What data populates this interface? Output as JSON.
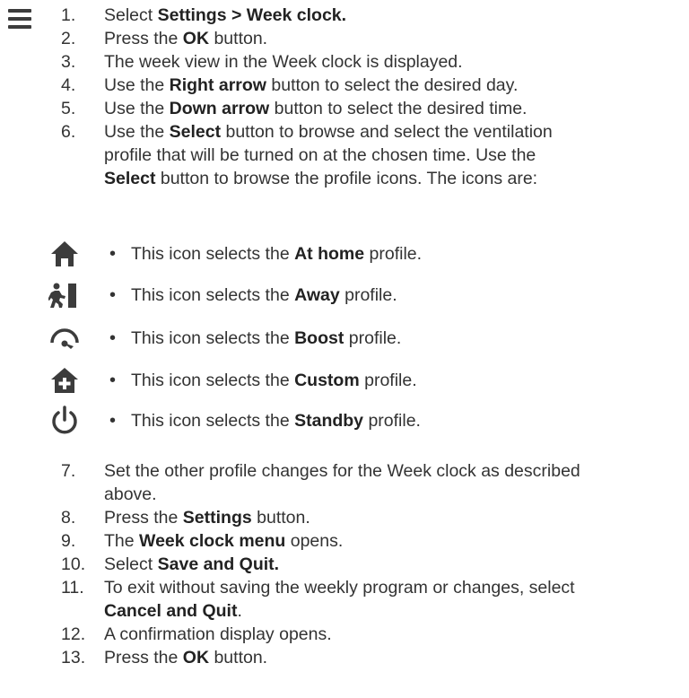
{
  "steps_a": [
    {
      "num": "1.",
      "parts": [
        {
          "t": "Select "
        },
        {
          "b": "Settings > Week clock."
        }
      ]
    },
    {
      "num": "2.",
      "parts": [
        {
          "t": "Press the "
        },
        {
          "b": "OK"
        },
        {
          "t": " button."
        }
      ]
    },
    {
      "num": "3.",
      "parts": [
        {
          "t": "The week view in the Week clock is displayed."
        }
      ]
    },
    {
      "num": "4.",
      "parts": [
        {
          "t": "Use the "
        },
        {
          "b": "Right arrow"
        },
        {
          "t": " button to select the desired day."
        }
      ]
    },
    {
      "num": "5.",
      "parts": [
        {
          "t": "Use the "
        },
        {
          "b": "Down arrow"
        },
        {
          "t": " button to select the desired time."
        }
      ]
    },
    {
      "num": "6.",
      "lines": [
        [
          {
            "t": "Use the "
          },
          {
            "b": "Select"
          },
          {
            "t": " button to browse and select the ventilation"
          }
        ],
        [
          {
            "t": "profile that will be turned on at the chosen time. Use the"
          }
        ],
        [
          {
            "b": "Select"
          },
          {
            "t": " button to browse the profile icons. The icons are:"
          }
        ]
      ]
    }
  ],
  "profiles": [
    {
      "icon": "home-icon",
      "pre": "This icon selects the ",
      "name": "At home",
      "post": " profile."
    },
    {
      "icon": "away-icon",
      "pre": "This icon selects the ",
      "name": "Away",
      "post": " profile."
    },
    {
      "icon": "boost-icon",
      "pre": "This icon selects the ",
      "name": "Boost",
      "post": " profile."
    },
    {
      "icon": "custom-home-icon",
      "pre": "This icon selects the ",
      "name": "Custom",
      "post": " profile."
    },
    {
      "icon": "power-icon",
      "pre": "This icon selects the ",
      "name": "Standby",
      "post": " profile."
    }
  ],
  "bullet": "•",
  "steps_b": [
    {
      "num": "7.",
      "lines": [
        [
          {
            "t": "Set the other profile changes for the Week clock as described"
          }
        ],
        [
          {
            "t": "above."
          }
        ]
      ]
    },
    {
      "num": "8.",
      "parts": [
        {
          "t": "Press the "
        },
        {
          "b": "Settings"
        },
        {
          "t": " button."
        }
      ]
    },
    {
      "num": "9.",
      "parts": [
        {
          "t": "The "
        },
        {
          "b": "Week clock menu"
        },
        {
          "t": " opens."
        }
      ]
    },
    {
      "num": "10.",
      "parts": [
        {
          "t": "Select "
        },
        {
          "b": "Save and Quit."
        }
      ]
    },
    {
      "num": "11.",
      "lines": [
        [
          {
            "t": "To exit without saving the weekly program or changes, select"
          }
        ],
        [
          {
            "b": "Cancel and Quit"
          },
          {
            "t": "."
          }
        ]
      ]
    },
    {
      "num": "12.",
      "parts": [
        {
          "t": "A confirmation display opens."
        }
      ]
    },
    {
      "num": "13.",
      "parts": [
        {
          "t": "Press the "
        },
        {
          "b": "OK"
        },
        {
          "t": " button."
        }
      ]
    }
  ],
  "colors": {
    "text": "#333333",
    "icon": "#3c3c3c"
  }
}
